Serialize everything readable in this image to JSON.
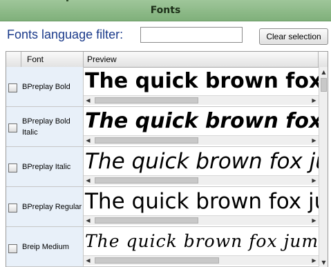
{
  "window": {
    "title": "Fonts"
  },
  "filter": {
    "label": "Fonts language filter:",
    "value": "",
    "placeholder": ""
  },
  "clear_button": {
    "label": "Clear selection"
  },
  "table": {
    "columns": {
      "check": "",
      "font": "Font",
      "preview": "Preview"
    },
    "preview_text": "The quick brown fox jumps over the lazy dog",
    "rows": [
      {
        "font": "BPreplay Bold",
        "checked": false
      },
      {
        "font": "BPreplay Bold Italic",
        "checked": false
      },
      {
        "font": "BPreplay Italic",
        "checked": false
      },
      {
        "font": "BPreplay Regular",
        "checked": false
      },
      {
        "font": "Breip Medium",
        "checked": false
      }
    ]
  },
  "icons": {
    "scroll_left": "arrow-left-icon",
    "scroll_right": "arrow-right-icon",
    "scroll_up": "arrow-up-icon",
    "scroll_down": "arrow-down-icon"
  },
  "colors": {
    "titlebar": "#8fbb8a",
    "filter_label": "#1a3a8a",
    "row_label_bg": "#e8f0f9"
  }
}
